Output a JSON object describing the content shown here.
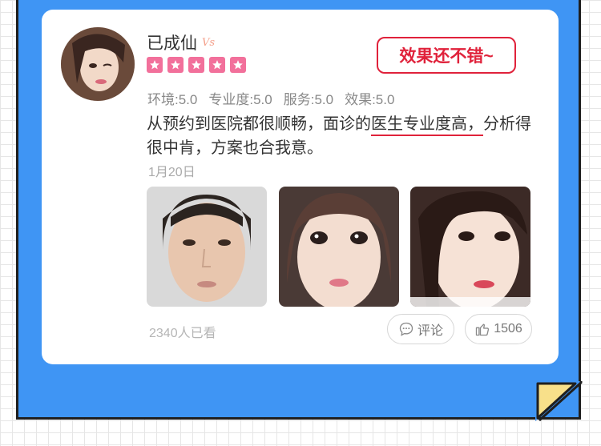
{
  "user": {
    "name": "已成仙",
    "vip_tag": "Vs",
    "rating_stars": 5
  },
  "badge": {
    "label": "效果还不错~"
  },
  "ratings": [
    {
      "label": "环境:5.0"
    },
    {
      "label": "专业度:5.0"
    },
    {
      "label": "服务:5.0"
    },
    {
      "label": "效果:5.0"
    }
  ],
  "review": {
    "part1": "从预约到医院都很顺畅，面诊的",
    "highlight": "医生专业度高，",
    "part2": "分析得很中肯，方案也合我意。"
  },
  "date": "1月20日",
  "photos": [
    {
      "label": "before-face"
    },
    {
      "label": "after-face-1"
    },
    {
      "label": "after-face-2"
    }
  ],
  "footer": {
    "views": "2340人已看",
    "comment_label": "评论",
    "like_count": "1506"
  },
  "colors": {
    "frame": "#3f95f4",
    "accent_red": "#e0223b",
    "star_pink": "#f2709b",
    "fold_yellow": "#f8e08a"
  }
}
